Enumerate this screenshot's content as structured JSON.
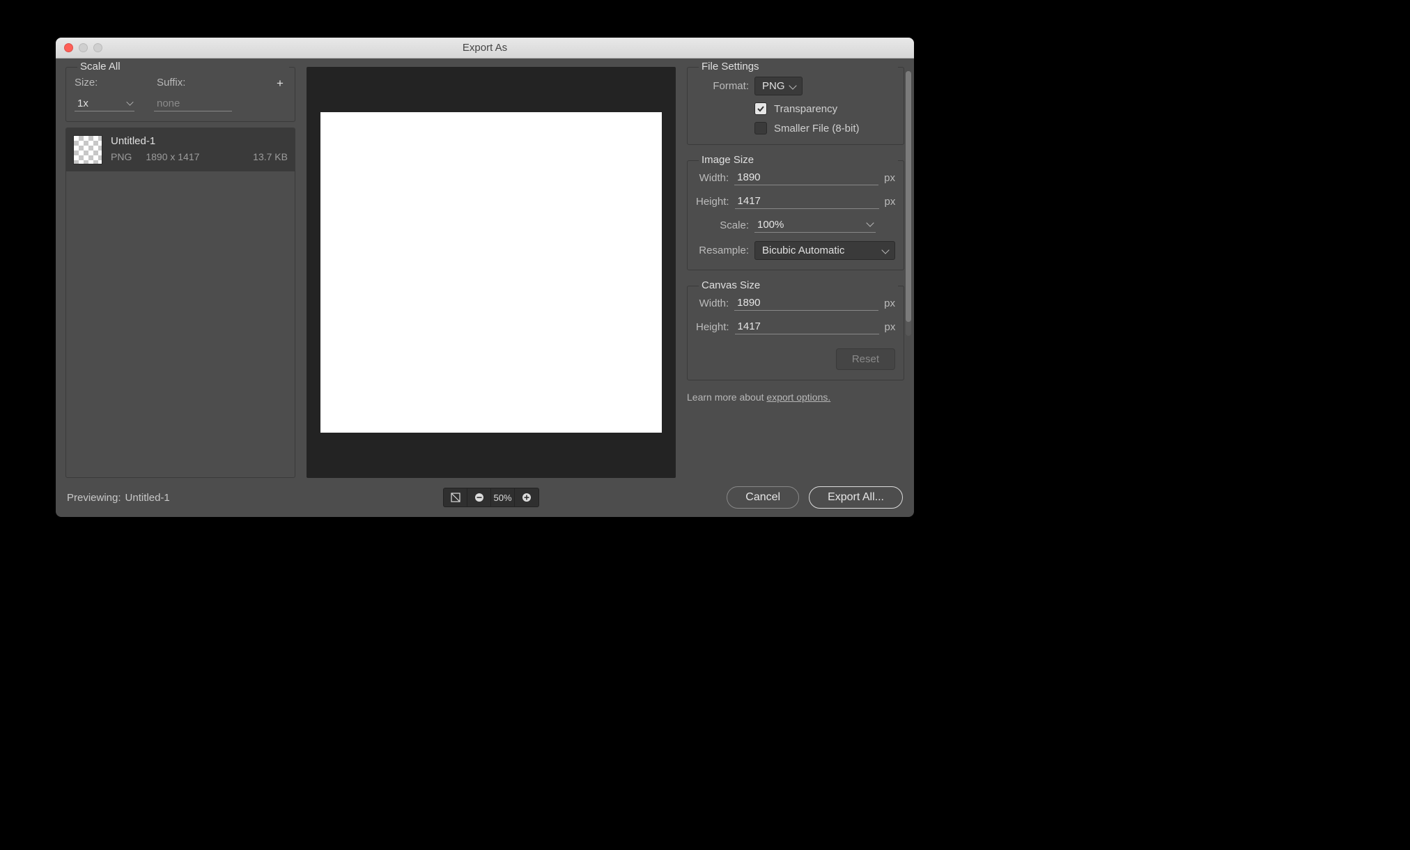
{
  "title": "Export As",
  "left": {
    "scale_all_label": "Scale All",
    "size_label": "Size:",
    "suffix_label": "Suffix:",
    "size_value": "1x",
    "suffix_placeholder": "none",
    "asset": {
      "name": "Untitled-1",
      "format": "PNG",
      "dimensions": "1890 x 1417",
      "file_size": "13.7 KB"
    }
  },
  "right": {
    "file_settings_label": "File Settings",
    "format_label": "Format:",
    "format_value": "PNG",
    "transparency_label": "Transparency",
    "transparency_checked": true,
    "smaller_label": "Smaller File (8-bit)",
    "smaller_checked": false,
    "image_size_label": "Image Size",
    "width_label": "Width:",
    "width_value": "1890",
    "height_label": "Height:",
    "height_value": "1417",
    "scale_label": "Scale:",
    "scale_value": "100%",
    "resample_label": "Resample:",
    "resample_value": "Bicubic Automatic",
    "canvas_size_label": "Canvas Size",
    "canvas_width": "1890",
    "canvas_height": "1417",
    "reset_label": "Reset",
    "px_unit": "px",
    "learn_prefix": "Learn more about ",
    "learn_link": "export options."
  },
  "footer": {
    "preview_label": "Previewing:",
    "preview_name": "Untitled-1",
    "zoom": "50%",
    "cancel": "Cancel",
    "export": "Export All..."
  }
}
